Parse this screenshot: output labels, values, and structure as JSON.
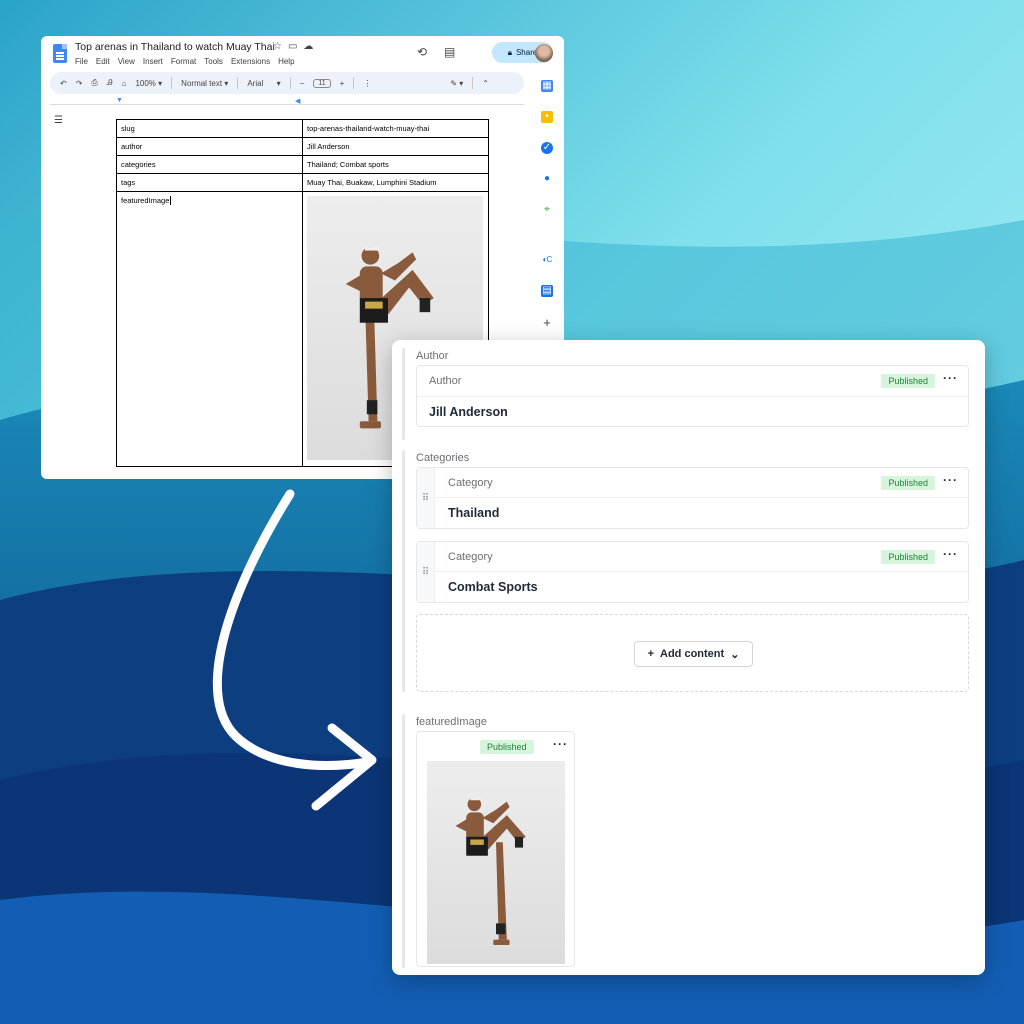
{
  "background": {
    "colors": [
      "#8fe6ef",
      "#0a4d8c",
      "#0d2a66"
    ]
  },
  "docs": {
    "title": "Top arenas in Thailand to watch Muay Thai",
    "menu": [
      "File",
      "Edit",
      "View",
      "Insert",
      "Format",
      "Tools",
      "Extensions",
      "Help"
    ],
    "share_label": "Share",
    "toolbar": {
      "zoom": "100%",
      "style": "Normal text",
      "font": "Arial",
      "font_size": "11"
    },
    "table": [
      {
        "key": "slug",
        "value": "top-arenas-thailand-watch-muay-thai"
      },
      {
        "key": "author",
        "value": "Jill Anderson"
      },
      {
        "key": "categories",
        "value": "Thailand; Combat sports"
      },
      {
        "key": "tags",
        "value": "Muay Thai, Buakaw, Lumphini Stadium"
      },
      {
        "key": "featuredImage",
        "value": ""
      }
    ],
    "icons": [
      "docs-logo-icon",
      "star-icon",
      "folder-icon",
      "cloud-icon",
      "history-icon",
      "comment-icon",
      "lock-icon",
      "outline-icon"
    ]
  },
  "cms": {
    "author": {
      "section_label": "Author",
      "type": "Author",
      "name": "Jill Anderson",
      "status": "Published"
    },
    "categories": {
      "section_label": "Categories",
      "items": [
        {
          "type": "Category",
          "name": "Thailand",
          "status": "Published"
        },
        {
          "type": "Category",
          "name": "Combat Sports",
          "status": "Published"
        }
      ],
      "add_label": "Add content"
    },
    "featured": {
      "section_label": "featuredImage",
      "status": "Published"
    },
    "badge_color": "#d6f5dc"
  }
}
